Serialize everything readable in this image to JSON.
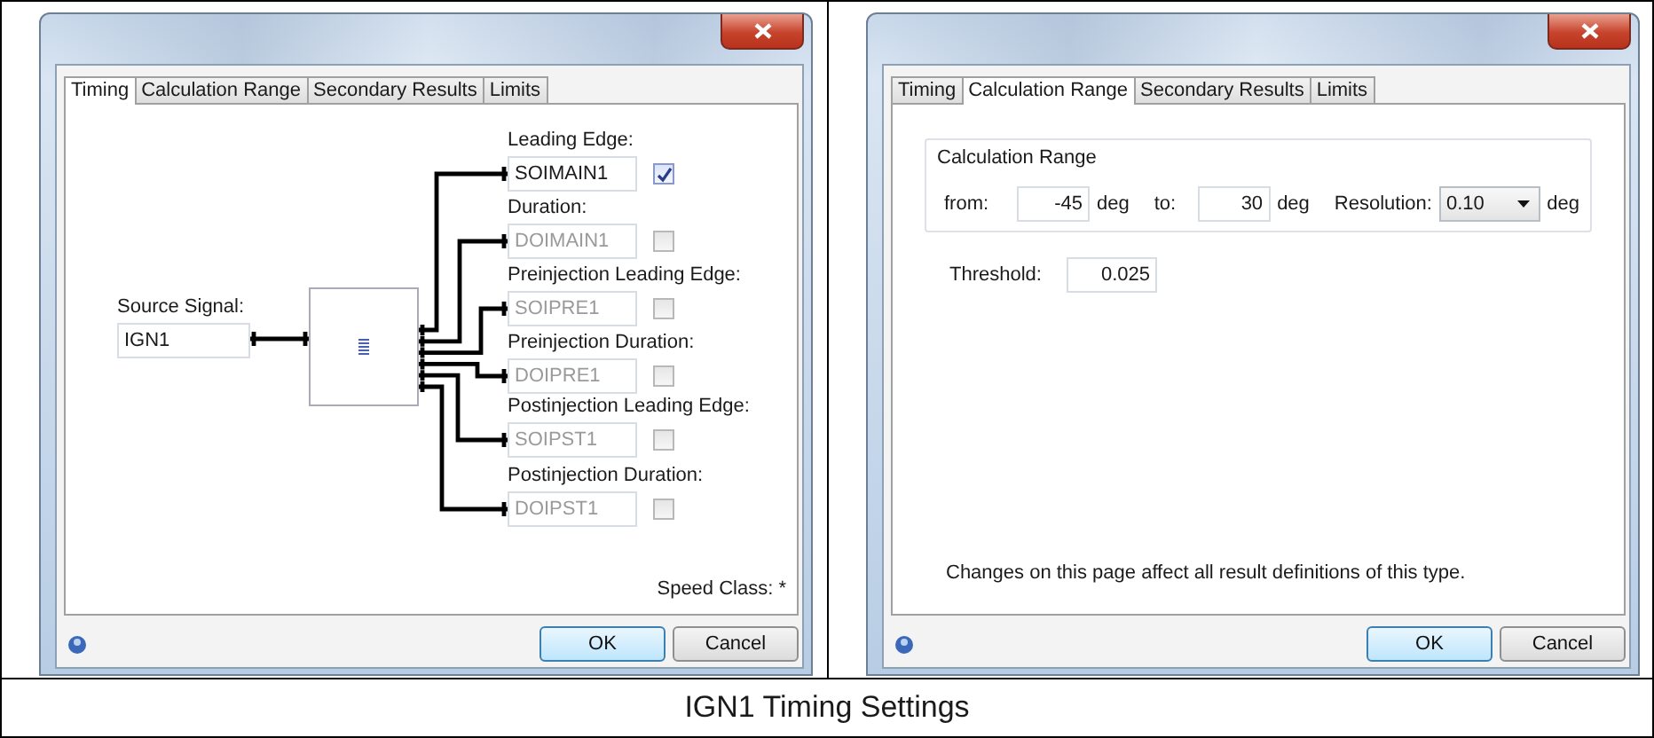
{
  "panels": [
    {
      "kind": "timing",
      "tabs": [
        {
          "label": "Timing",
          "selected": true
        },
        {
          "label": "Calculation Range",
          "selected": false
        },
        {
          "label": "Secondary Results",
          "selected": false
        },
        {
          "label": "Limits",
          "selected": false
        }
      ],
      "source": {
        "label": "Source Signal:",
        "value": "IGN1"
      },
      "outputs": [
        {
          "label": "Leading Edge:",
          "value": "SOIMAIN1",
          "checked": true
        },
        {
          "label": "Duration:",
          "value": "DOIMAIN1",
          "checked": false
        },
        {
          "label": "Preinjection Leading Edge:",
          "value": "SOIPRE1",
          "checked": false
        },
        {
          "label": "Preinjection Duration:",
          "value": "DOIPRE1",
          "checked": false
        },
        {
          "label": "Postinjection Leading Edge:",
          "value": "SOIPST1",
          "checked": false
        },
        {
          "label": "Postinjection Duration:",
          "value": "DOIPST1",
          "checked": false
        }
      ],
      "speed_class": "Speed Class: *",
      "buttons": {
        "ok": "OK",
        "cancel": "Cancel"
      }
    },
    {
      "kind": "range",
      "tabs": [
        {
          "label": "Timing",
          "selected": false
        },
        {
          "label": "Calculation Range",
          "selected": true
        },
        {
          "label": "Secondary Results",
          "selected": false
        },
        {
          "label": "Limits",
          "selected": false
        }
      ],
      "group": {
        "title": "Calculation Range",
        "from_label": "from:",
        "from_value": "-45",
        "from_unit": "deg",
        "to_label": "to:",
        "to_value": "30",
        "to_unit": "deg",
        "resolution_label": "Resolution:",
        "resolution_value": "0.10",
        "resolution_unit": "deg"
      },
      "threshold": {
        "label": "Threshold:",
        "value": "0.025"
      },
      "note": "Changes on this page affect all result definitions of this type.",
      "buttons": {
        "ok": "OK",
        "cancel": "Cancel"
      }
    }
  ],
  "caption": "IGN1 Timing Settings"
}
